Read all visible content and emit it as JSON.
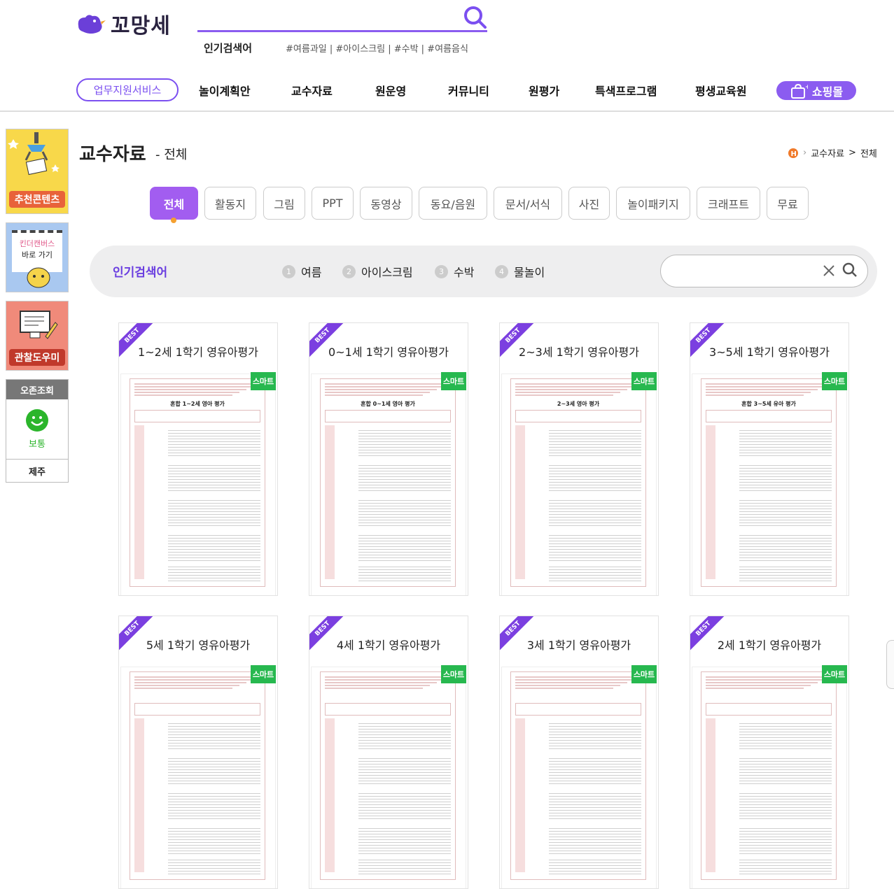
{
  "header": {
    "logo_text": "꼬망세",
    "popular_label": "인기검색어",
    "popular_tags": "#여름과일 | #아이스크림 | #수박 | #여름음식"
  },
  "nav": {
    "business": "업무지원서비스",
    "items": [
      "놀이계획안",
      "교수자료",
      "원운영",
      "커뮤니티",
      "원평가",
      "특색프로그램",
      "평생교육원"
    ],
    "shop": "쇼핑몰"
  },
  "sidebar": {
    "banner1": "추천콘텐츠",
    "banner2_line1": "킨더캔버스",
    "banner2_line2": "바로 가기",
    "banner3": "관찰도우미",
    "weather_title": "오존조회",
    "weather_status": "보통",
    "weather_region": "제주"
  },
  "page": {
    "title": "교수자료",
    "subtitle": "- 전체",
    "breadcrumb": [
      "교수자료",
      ">",
      "전체"
    ]
  },
  "categories": [
    "전체",
    "활동지",
    "그림",
    "PPT",
    "동영상",
    "동요/음원",
    "문서/서식",
    "사진",
    "놀이패키지",
    "크래프트",
    "무료"
  ],
  "search": {
    "label": "인기검색어",
    "keywords": [
      {
        "n": "1",
        "t": "여름"
      },
      {
        "n": "2",
        "t": "아이스크림"
      },
      {
        "n": "3",
        "t": "수박"
      },
      {
        "n": "4",
        "t": "물놀이"
      }
    ],
    "placeholder": ""
  },
  "cards": [
    {
      "badge": "BEST",
      "title": "1~2세 1학기 영유아평가",
      "tag": "스마트",
      "doc_title": "혼합 1~2세 영아 평가"
    },
    {
      "badge": "BEST",
      "title": "0~1세 1학기 영유아평가",
      "tag": "스마트",
      "doc_title": "혼합 0~1세 영아 평가"
    },
    {
      "badge": "BEST",
      "title": "2~3세 1학기 영유아평가",
      "tag": "스마트",
      "doc_title": "2~3세 영아 평가"
    },
    {
      "badge": "BEST",
      "title": "3~5세 1학기 영유아평가",
      "tag": "스마트",
      "doc_title": "혼합 3~5세 유아 평가"
    },
    {
      "badge": "BEST",
      "title": "5세 1학기 영유아평가",
      "tag": "스마트",
      "doc_title": ""
    },
    {
      "badge": "BEST",
      "title": "4세 1학기 영유아평가",
      "tag": "스마트",
      "doc_title": ""
    },
    {
      "badge": "BEST",
      "title": "3세 1학기 영유아평가",
      "tag": "스마트",
      "doc_title": ""
    },
    {
      "badge": "BEST",
      "title": "2세 1학기 영유아평가",
      "tag": "스마트",
      "doc_title": ""
    }
  ],
  "colors": {
    "accent": "#7b4ff0",
    "active_tab": "#a25df0",
    "smart": "#27b84f",
    "best": "#7b3fe0"
  }
}
